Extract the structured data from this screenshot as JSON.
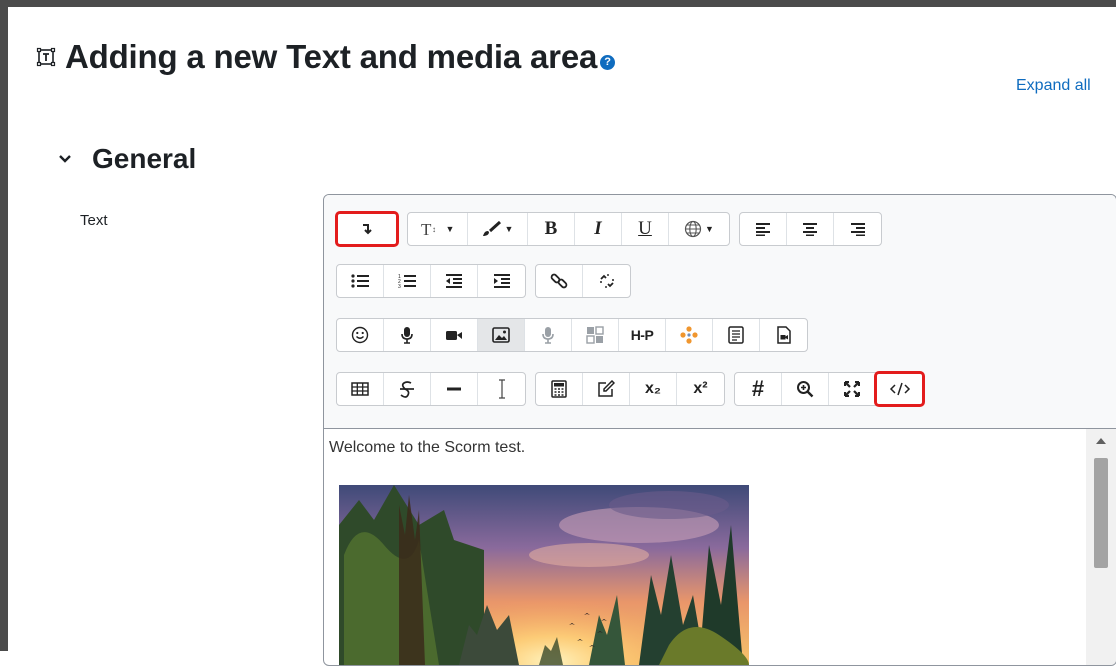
{
  "page": {
    "title": "Adding a new Text and media area",
    "help_glyph": "?",
    "expand_all": "Expand all",
    "section": "General",
    "field_label": "Text",
    "icons": {
      "title": "text-media-area-icon",
      "help": "help-icon",
      "section": "chevron-down-icon"
    }
  },
  "editor": {
    "toolbar": {
      "row1": {
        "toggle": {
          "icon": "show-more-buttons-icon",
          "highlighted": true
        },
        "paragraph_styles": {
          "icon": "paragraph-styles-icon"
        },
        "font_color": {
          "icon": "font-color-icon"
        },
        "bold_label": "B",
        "italic_label": "I",
        "underline_label": "U",
        "language": {
          "icon": "globe-icon"
        },
        "align": [
          "align-left-icon",
          "align-center-icon",
          "align-right-icon"
        ]
      },
      "row2": [
        "unordered-list-icon",
        "ordered-list-icon",
        "outdent-icon",
        "indent-icon",
        "link-icon",
        "unlink-icon"
      ],
      "row3": {
        "h5p_label": "H-P",
        "icons": [
          "emoji-icon",
          "record-audio-icon",
          "record-video-icon",
          "insert-image-icon",
          "media-icon",
          "manage-files-icon",
          "h5p-icon",
          "molecule-icon",
          "template-icon",
          "file-embed-icon"
        ]
      },
      "row4": {
        "subscript_label": "x₂",
        "superscript_label": "x²",
        "hash_label": "#",
        "icons": [
          "table-icon",
          "strikethrough-icon",
          "horizontal-rule-icon",
          "text-cursor-icon",
          "equation-icon",
          "edit-icon",
          "subscript-icon",
          "superscript-icon",
          "hash-icon",
          "zoom-icon",
          "fullscreen-icon",
          "html-source-icon"
        ],
        "html_highlighted": true
      }
    },
    "content_text": "Welcome to the Scorm test.",
    "content_image": "sunset-forest-image"
  },
  "colors": {
    "link": "#0f6cbf",
    "highlight": "#e31c1c",
    "frame": "#4b4b4b"
  }
}
